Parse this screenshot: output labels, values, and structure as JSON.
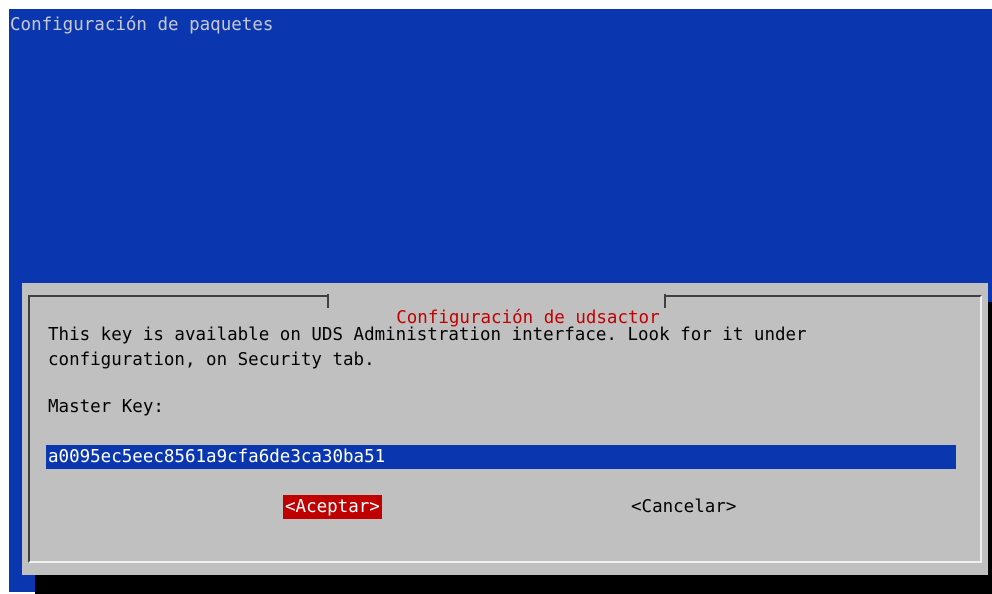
{
  "backtitle": "Configuración de paquetes",
  "dialog": {
    "title": "Configuración de udsactor",
    "message_line1": "This key is available on UDS Administration interface. Look for it under",
    "message_line2": "configuration, on Security tab.",
    "field_label": "Master Key:",
    "field_value": "a0095ec5eec8561a9cfa6de3ca30ba51",
    "ok_label": "<Aceptar>",
    "cancel_label": "<Cancelar>"
  },
  "colors": {
    "background": "#0a37b0",
    "dialog": "#c0c0c0",
    "title_text": "#c00000",
    "focused_button": "#c00000",
    "input_background": "#0a37b0"
  }
}
